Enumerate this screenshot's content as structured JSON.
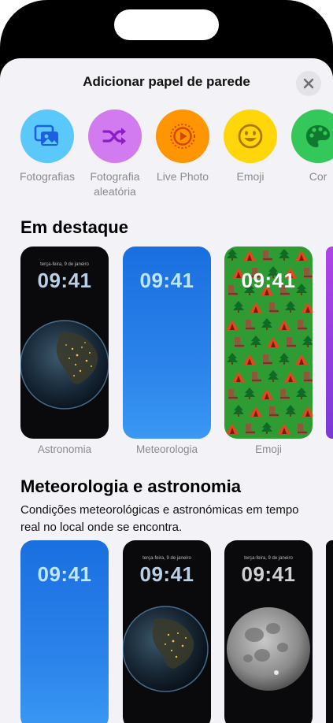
{
  "sheet": {
    "title": "Adicionar papel de parede"
  },
  "categories": [
    {
      "label": "Fotografias",
      "color": "#5ac8fa",
      "icon": "photos-icon"
    },
    {
      "label": "Fotografia\naleatória",
      "color": "#d27bf0",
      "icon": "shuffle-icon"
    },
    {
      "label": "Live Photo",
      "color": "#ff9500",
      "icon": "live-photo-icon"
    },
    {
      "label": "Emoji",
      "color": "#ffd60a",
      "icon": "smiley-icon"
    },
    {
      "label": "Cor",
      "color": "#34c759",
      "icon": "palette-icon"
    }
  ],
  "featured": {
    "title": "Em destaque",
    "cards": [
      {
        "label": "Astronomia",
        "date": "terça-feira, 9 de janeiro",
        "time": "09:41"
      },
      {
        "label": "Meteorologia",
        "date": "",
        "time": "09:41"
      },
      {
        "label": "Emoji",
        "date": "",
        "time": "09:41"
      }
    ]
  },
  "weather_astro": {
    "title": "Meteorologia e astronomia",
    "description": "Condições meteorológicas e astronómicas em tempo real no local onde se encontra.",
    "cards": [
      {
        "date": "",
        "time": "09:41"
      },
      {
        "date": "terça-feira, 9 de janeiro",
        "time": "09:41"
      },
      {
        "date": "terça-feira, 9 de janeiro",
        "time": "09:41"
      }
    ]
  },
  "colors": {
    "sheet_bg": "#f2f2f7",
    "label_gray": "#8a8a8e"
  }
}
